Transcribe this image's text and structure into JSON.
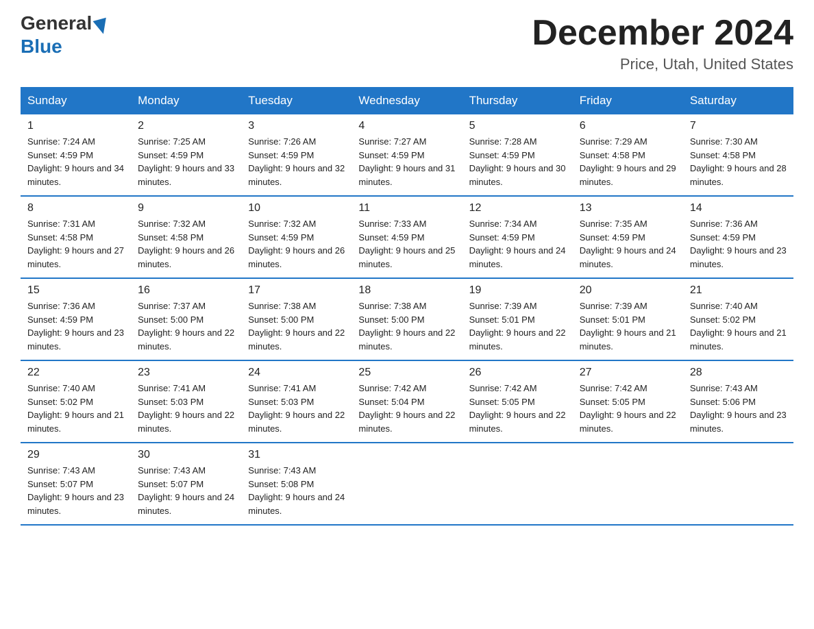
{
  "header": {
    "logo_line1": "General",
    "logo_line2": "Blue",
    "month_title": "December 2024",
    "location": "Price, Utah, United States"
  },
  "weekdays": [
    "Sunday",
    "Monday",
    "Tuesday",
    "Wednesday",
    "Thursday",
    "Friday",
    "Saturday"
  ],
  "weeks": [
    [
      {
        "day": "1",
        "sunrise": "7:24 AM",
        "sunset": "4:59 PM",
        "daylight": "9 hours and 34 minutes."
      },
      {
        "day": "2",
        "sunrise": "7:25 AM",
        "sunset": "4:59 PM",
        "daylight": "9 hours and 33 minutes."
      },
      {
        "day": "3",
        "sunrise": "7:26 AM",
        "sunset": "4:59 PM",
        "daylight": "9 hours and 32 minutes."
      },
      {
        "day": "4",
        "sunrise": "7:27 AM",
        "sunset": "4:59 PM",
        "daylight": "9 hours and 31 minutes."
      },
      {
        "day": "5",
        "sunrise": "7:28 AM",
        "sunset": "4:59 PM",
        "daylight": "9 hours and 30 minutes."
      },
      {
        "day": "6",
        "sunrise": "7:29 AM",
        "sunset": "4:58 PM",
        "daylight": "9 hours and 29 minutes."
      },
      {
        "day": "7",
        "sunrise": "7:30 AM",
        "sunset": "4:58 PM",
        "daylight": "9 hours and 28 minutes."
      }
    ],
    [
      {
        "day": "8",
        "sunrise": "7:31 AM",
        "sunset": "4:58 PM",
        "daylight": "9 hours and 27 minutes."
      },
      {
        "day": "9",
        "sunrise": "7:32 AM",
        "sunset": "4:58 PM",
        "daylight": "9 hours and 26 minutes."
      },
      {
        "day": "10",
        "sunrise": "7:32 AM",
        "sunset": "4:59 PM",
        "daylight": "9 hours and 26 minutes."
      },
      {
        "day": "11",
        "sunrise": "7:33 AM",
        "sunset": "4:59 PM",
        "daylight": "9 hours and 25 minutes."
      },
      {
        "day": "12",
        "sunrise": "7:34 AM",
        "sunset": "4:59 PM",
        "daylight": "9 hours and 24 minutes."
      },
      {
        "day": "13",
        "sunrise": "7:35 AM",
        "sunset": "4:59 PM",
        "daylight": "9 hours and 24 minutes."
      },
      {
        "day": "14",
        "sunrise": "7:36 AM",
        "sunset": "4:59 PM",
        "daylight": "9 hours and 23 minutes."
      }
    ],
    [
      {
        "day": "15",
        "sunrise": "7:36 AM",
        "sunset": "4:59 PM",
        "daylight": "9 hours and 23 minutes."
      },
      {
        "day": "16",
        "sunrise": "7:37 AM",
        "sunset": "5:00 PM",
        "daylight": "9 hours and 22 minutes."
      },
      {
        "day": "17",
        "sunrise": "7:38 AM",
        "sunset": "5:00 PM",
        "daylight": "9 hours and 22 minutes."
      },
      {
        "day": "18",
        "sunrise": "7:38 AM",
        "sunset": "5:00 PM",
        "daylight": "9 hours and 22 minutes."
      },
      {
        "day": "19",
        "sunrise": "7:39 AM",
        "sunset": "5:01 PM",
        "daylight": "9 hours and 22 minutes."
      },
      {
        "day": "20",
        "sunrise": "7:39 AM",
        "sunset": "5:01 PM",
        "daylight": "9 hours and 21 minutes."
      },
      {
        "day": "21",
        "sunrise": "7:40 AM",
        "sunset": "5:02 PM",
        "daylight": "9 hours and 21 minutes."
      }
    ],
    [
      {
        "day": "22",
        "sunrise": "7:40 AM",
        "sunset": "5:02 PM",
        "daylight": "9 hours and 21 minutes."
      },
      {
        "day": "23",
        "sunrise": "7:41 AM",
        "sunset": "5:03 PM",
        "daylight": "9 hours and 22 minutes."
      },
      {
        "day": "24",
        "sunrise": "7:41 AM",
        "sunset": "5:03 PM",
        "daylight": "9 hours and 22 minutes."
      },
      {
        "day": "25",
        "sunrise": "7:42 AM",
        "sunset": "5:04 PM",
        "daylight": "9 hours and 22 minutes."
      },
      {
        "day": "26",
        "sunrise": "7:42 AM",
        "sunset": "5:05 PM",
        "daylight": "9 hours and 22 minutes."
      },
      {
        "day": "27",
        "sunrise": "7:42 AM",
        "sunset": "5:05 PM",
        "daylight": "9 hours and 22 minutes."
      },
      {
        "day": "28",
        "sunrise": "7:43 AM",
        "sunset": "5:06 PM",
        "daylight": "9 hours and 23 minutes."
      }
    ],
    [
      {
        "day": "29",
        "sunrise": "7:43 AM",
        "sunset": "5:07 PM",
        "daylight": "9 hours and 23 minutes."
      },
      {
        "day": "30",
        "sunrise": "7:43 AM",
        "sunset": "5:07 PM",
        "daylight": "9 hours and 24 minutes."
      },
      {
        "day": "31",
        "sunrise": "7:43 AM",
        "sunset": "5:08 PM",
        "daylight": "9 hours and 24 minutes."
      },
      null,
      null,
      null,
      null
    ]
  ],
  "labels": {
    "sunrise": "Sunrise:",
    "sunset": "Sunset:",
    "daylight": "Daylight:"
  }
}
